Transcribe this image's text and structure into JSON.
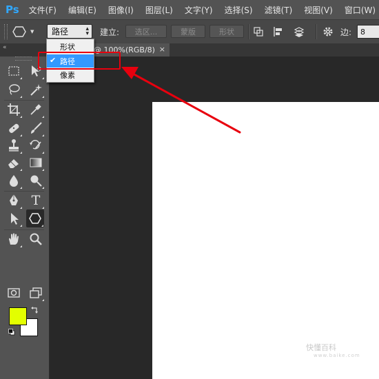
{
  "app": {
    "logo": "Ps"
  },
  "menubar": {
    "items": [
      "文件(F)",
      "编辑(E)",
      "图像(I)",
      "图层(L)",
      "文字(Y)",
      "选择(S)",
      "滤镜(T)",
      "视图(V)",
      "窗口(W)"
    ]
  },
  "options_bar": {
    "tool_preset_icon": "hexagon-icon",
    "mode_value": "路径",
    "make_label": "建立:",
    "selection_button": "选区...",
    "mask_button": "蒙版",
    "shape_button": "形状",
    "sides_label": "边:",
    "sides_value": "8"
  },
  "tabs": {
    "collapse_glyph": "«",
    "doc_tab_title": "@ 100%(RGB/8)",
    "close_glyph": "×"
  },
  "mode_dropdown": {
    "items": [
      "形状",
      "路径",
      "像素"
    ],
    "selected": "路径",
    "check_glyph": "✔"
  },
  "toolbar": {
    "tools": [
      "rect-marquee-icon",
      "move-icon",
      "lasso-icon",
      "magic-wand-icon",
      "crop-icon",
      "eyedropper-icon",
      "healing-brush-icon",
      "brush-icon",
      "clone-stamp-icon",
      "history-brush-icon",
      "eraser-icon",
      "gradient-icon",
      "blur-icon",
      "dodge-icon",
      "pen-icon",
      "type-icon",
      "path-selection-icon",
      "polygon-icon",
      "hand-icon",
      "zoom-icon",
      "quick-mask-icon",
      "screen-mode-icon"
    ],
    "type_glyph": "T",
    "active_tool": "polygon-icon",
    "foreground_color": "#e3ff00",
    "background_color": "#ffffff"
  },
  "colors": {
    "annotation": "#e8000e",
    "selection_highlight": "#3399ff",
    "logo": "#31a8ff"
  },
  "watermark": {
    "text": "快懂百科",
    "sub": "www.baike.com"
  }
}
